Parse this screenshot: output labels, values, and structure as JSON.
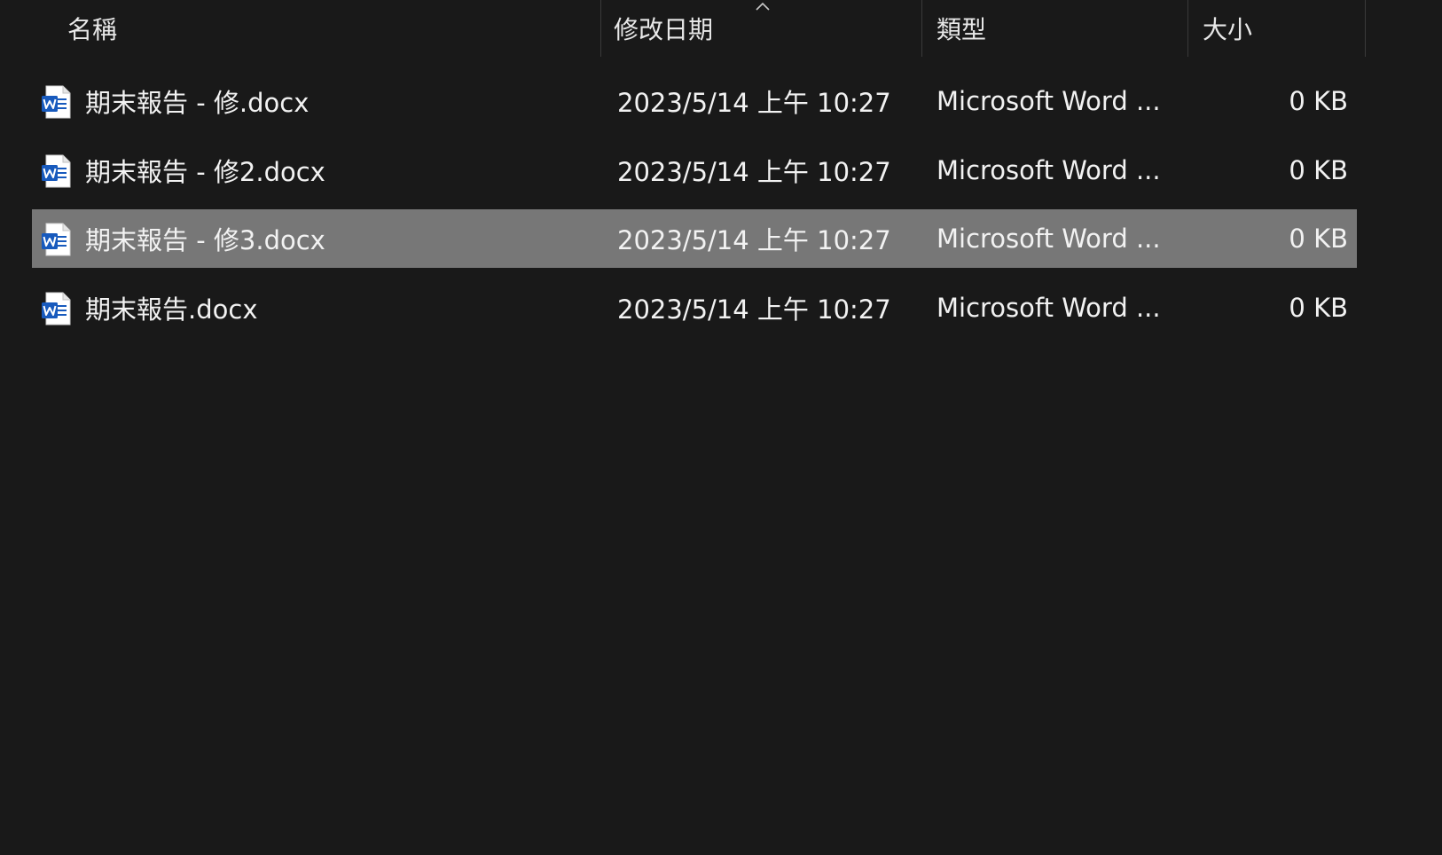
{
  "columns": {
    "name": "名稱",
    "modified": "修改日期",
    "type": "類型",
    "size": "大小"
  },
  "sort": {
    "column": "modified",
    "indicator": "chevron-up-icon"
  },
  "files": [
    {
      "name": "期末報告 - 修.docx",
      "modified": "2023/5/14 上午 10:27",
      "type": "Microsoft Word ...",
      "size": "0 KB",
      "icon": "word-document-icon",
      "selected": false
    },
    {
      "name": "期末報告 - 修2.docx",
      "modified": "2023/5/14 上午 10:27",
      "type": "Microsoft Word ...",
      "size": "0 KB",
      "icon": "word-document-icon",
      "selected": false
    },
    {
      "name": "期末報告 - 修3.docx",
      "modified": "2023/5/14 上午 10:27",
      "type": "Microsoft Word ...",
      "size": "0 KB",
      "icon": "word-document-icon",
      "selected": true
    },
    {
      "name": "期末報告.docx",
      "modified": "2023/5/14 上午 10:27",
      "type": "Microsoft Word ...",
      "size": "0 KB",
      "icon": "word-document-icon",
      "selected": false
    }
  ],
  "colors": {
    "background": "#191919",
    "selection": "#777777",
    "text": "#f2f2f2",
    "divider": "#3a3a3a",
    "word_blue": "#185abd"
  }
}
